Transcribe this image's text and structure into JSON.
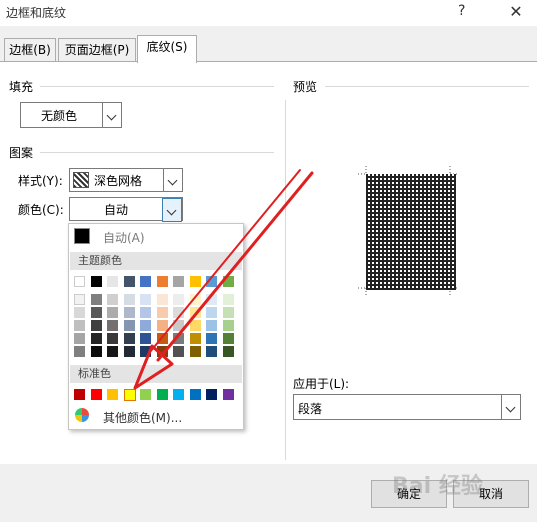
{
  "window": {
    "title": "边框和底纹",
    "help": "?",
    "close": "✕"
  },
  "tabs": [
    {
      "label": "边框(B)"
    },
    {
      "label": "页面边框(P)"
    },
    {
      "label": "底纹(S)"
    }
  ],
  "fill": {
    "heading": "填充",
    "value": "无颜色"
  },
  "pattern": {
    "heading": "图案",
    "style_label": "样式(Y):",
    "style_value": "深色网格",
    "color_label": "颜色(C):",
    "color_value": "自动"
  },
  "color_popup": {
    "auto_label": "自动(A)",
    "theme_header": "主题颜色",
    "standard_header": "标准色",
    "more_label": "其他颜色(M)...",
    "theme_top": [
      "#ffffff",
      "#000000",
      "#e7e6e6",
      "#44546a",
      "#4472c4",
      "#ed7d31",
      "#a5a5a5",
      "#ffc000",
      "#5b9bd5",
      "#70ad47"
    ],
    "theme_shades": [
      [
        "#f2f2f2",
        "#7f7f7f",
        "#d0cece",
        "#d6dce4",
        "#d9e2f3",
        "#fbe5d5",
        "#ededed",
        "#fff2cc",
        "#deebf6",
        "#e2efd9"
      ],
      [
        "#d8d8d8",
        "#595959",
        "#aeabab",
        "#adb9ca",
        "#b4c6e7",
        "#f7cbac",
        "#dbdbdb",
        "#fee599",
        "#bdd7ee",
        "#c5e0b3"
      ],
      [
        "#bfbfbf",
        "#3f3f3f",
        "#757070",
        "#8496b0",
        "#8eaadb",
        "#f4b183",
        "#c9c9c9",
        "#ffd965",
        "#9cc3e5",
        "#a8d08d"
      ],
      [
        "#a5a5a5",
        "#262626",
        "#3a3838",
        "#323f4f",
        "#2f5496",
        "#c55a11",
        "#7b7b7b",
        "#bf8f00",
        "#2e75b5",
        "#538135"
      ],
      [
        "#7f7f7f",
        "#0c0c0c",
        "#161616",
        "#222a35",
        "#1f3864",
        "#833c0b",
        "#525252",
        "#7f6000",
        "#1e4e79",
        "#375623"
      ]
    ],
    "standard": [
      "#c00000",
      "#ff0000",
      "#ffc000",
      "#ffff00",
      "#92d050",
      "#00b050",
      "#00b0f0",
      "#0070c0",
      "#002060",
      "#7030a0"
    ]
  },
  "preview": {
    "heading": "预览"
  },
  "apply_to": {
    "label": "应用于(L):",
    "value": "段落"
  },
  "buttons": {
    "ok": "确定",
    "cancel": "取消"
  },
  "watermark": "Bai 经验",
  "arrow_color": "#e02020"
}
